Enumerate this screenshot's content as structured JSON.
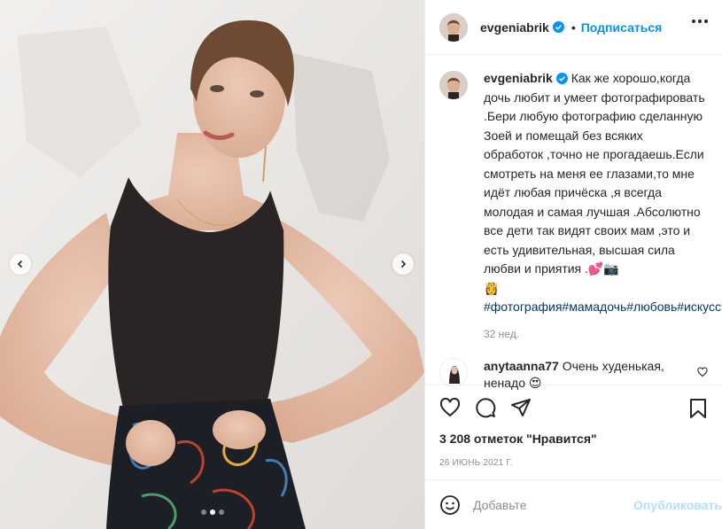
{
  "post": {
    "username": "evgeniabrik",
    "follow_label": "Подписаться",
    "separator": "•",
    "caption": "Как же хорошо,когда дочь любит и умеет фотографировать .Бери любую фотографию сделанную Зоей и помещай без всяких обработок ,точно не прогадаешь.Если смотреть на меня ее глазами,то мне идёт любая причёска ,я всегда молодая и самая лучшая .Абсолютно все дети так видят своих мам ,это и есть удивительная, высшая сила любви и приятия .💕📷",
    "emoji_line": "👸",
    "hashtags": "#фотография#мамадочь#любовь#искусство",
    "time_ago": "32 нед.",
    "likes_text": "3 208 отметок \"Нравится\"",
    "date": "26 ИЮНЬ 2021 Г."
  },
  "comment": {
    "username": "anytaanna77",
    "text": "Очень худенькая, ненадо 😍"
  },
  "add_comment": {
    "placeholder": "Добавьте",
    "publish_label": "Опубликовать"
  },
  "carousel": {
    "slide_count": 3,
    "active_index": 1
  },
  "icons": {
    "verified": "verified-badge-icon",
    "more": "more-options-icon",
    "like": "heart-icon",
    "comment": "comment-bubble-icon",
    "share": "paper-plane-icon",
    "save": "bookmark-icon",
    "emoji": "smiley-icon",
    "prev": "chevron-left-icon",
    "next": "chevron-right-icon"
  },
  "colors": {
    "accent": "#0095f6",
    "publish_disabled": "#b2dffc",
    "muted": "#8e8e8e",
    "hashtag": "#00376b"
  }
}
